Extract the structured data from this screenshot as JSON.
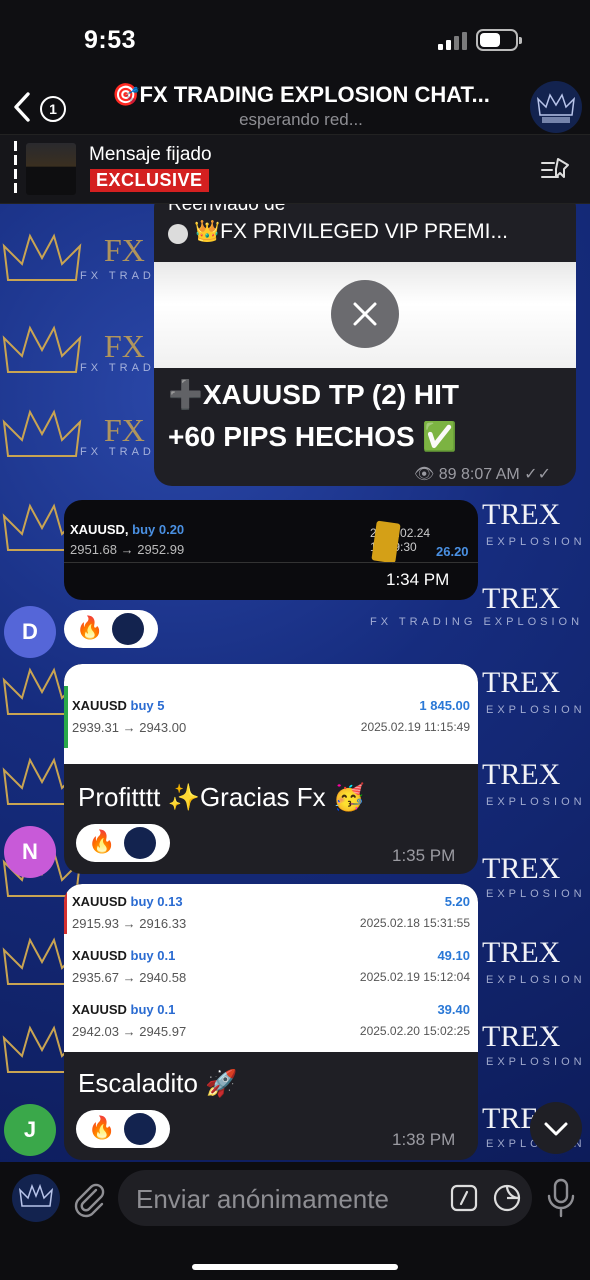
{
  "status": {
    "time": "9:53"
  },
  "header": {
    "back_count": "1",
    "title": "🎯FX TRADING EXPLOSION CHAT...",
    "subtitle": "esperando red..."
  },
  "pinned": {
    "label": "Mensaje fijado",
    "tag": "EXCLUSIVE"
  },
  "watermark": {
    "brand": "FX",
    "brand2": "TREX",
    "line": "FX TRADING",
    "line_full": "FX TRADING EXPLOSION",
    "explosion": "EXPLOSION"
  },
  "messages": {
    "forward": {
      "forwarded_label": "Reenviado de",
      "from": "👑FX PRIVILEGED VIP PREMI...",
      "line1": "➕XAUUSD TP (2) HIT",
      "line2": "+60 PIPS HECHOS ✅",
      "views": "89",
      "time": "8:07 AM"
    },
    "m1": {
      "symbol": "XAUUSD,",
      "side": "buy 0.20",
      "prices": "2951.68 → 2952.99",
      "date": "2025.02.24 15:49:30",
      "profit": "26.20",
      "time": "1:34 PM",
      "avatar_letter": "D"
    },
    "m2": {
      "symbol": "XAUUSD",
      "side": "buy 5",
      "prices": "2939.31 → 2943.00",
      "profit": "1 845.00",
      "date": "2025.02.19 11:15:49",
      "text": "Profitttt ✨Gracias Fx 🥳",
      "time": "1:35 PM",
      "avatar_letter": "N"
    },
    "m3": {
      "trades": [
        {
          "symbol": "XAUUSD",
          "side": "buy 0.13",
          "prices": "2915.93 → 2916.33",
          "profit": "5.20",
          "date": "2025.02.18 15:31:55"
        },
        {
          "symbol": "XAUUSD",
          "side": "buy 0.1",
          "prices": "2935.67 → 2940.58",
          "profit": "49.10",
          "date": "2025.02.19 15:12:04"
        },
        {
          "symbol": "XAUUSD",
          "side": "buy 0.1",
          "prices": "2942.03 → 2945.97",
          "profit": "39.40",
          "date": "2025.02.20 15:02:25"
        }
      ],
      "text": "Escaladito 🚀",
      "time": "1:38 PM",
      "avatar_letter": "J"
    }
  },
  "reaction": {
    "emoji": "🔥"
  },
  "input": {
    "placeholder": "Enviar anónimamente"
  },
  "colors": {
    "accent": "#2a78d6",
    "tag": "#d42020",
    "bubble": "#1f1f25"
  }
}
